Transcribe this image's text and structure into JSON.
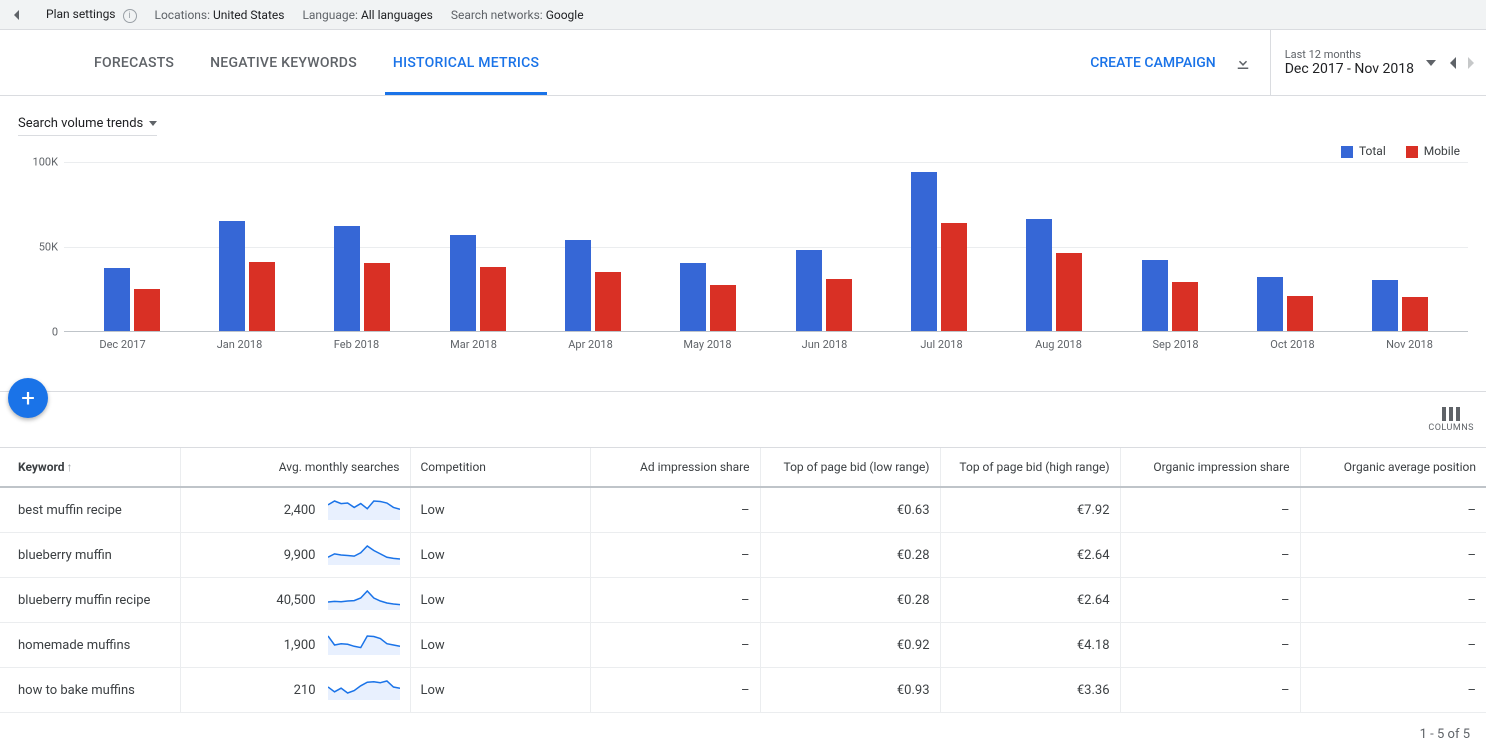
{
  "topbar": {
    "plan_settings": "Plan settings",
    "locations_label": "Locations:",
    "locations_value": "United States",
    "language_label": "Language:",
    "language_value": "All languages",
    "networks_label": "Search networks:",
    "networks_value": "Google"
  },
  "tabs": {
    "forecasts": "FORECASTS",
    "negative": "NEGATIVE KEYWORDS",
    "historical": "HISTORICAL METRICS"
  },
  "actions": {
    "create": "CREATE CAMPAIGN"
  },
  "date_picker": {
    "small": "Last 12 months",
    "range": "Dec 2017 - Nov 2018"
  },
  "chart": {
    "dropdown_label": "Search volume trends",
    "legend_total": "Total",
    "legend_mobile": "Mobile"
  },
  "chart_data": {
    "type": "bar",
    "categories": [
      "Dec 2017",
      "Jan 2018",
      "Feb 2018",
      "Mar 2018",
      "Apr 2018",
      "May 2018",
      "Jun 2018",
      "Jul 2018",
      "Aug 2018",
      "Sep 2018",
      "Oct 2018",
      "Nov 2018"
    ],
    "series": [
      {
        "name": "Total",
        "values": [
          37000,
          65000,
          62000,
          57000,
          54000,
          40000,
          48000,
          94000,
          66000,
          42000,
          32000,
          30000
        ]
      },
      {
        "name": "Mobile",
        "values": [
          25000,
          41000,
          40000,
          38000,
          35000,
          27000,
          31000,
          64000,
          46000,
          29000,
          21000,
          20000
        ]
      }
    ],
    "ylabel": "",
    "xlabel": "",
    "ylim": [
      0,
      100000
    ],
    "yticks": [
      "0",
      "50K",
      "100K"
    ],
    "colors": {
      "Total": "#3667d6",
      "Mobile": "#d93025"
    }
  },
  "columns_btn": "COLUMNS",
  "table": {
    "headers": {
      "keyword": "Keyword",
      "avg": "Avg. monthly searches",
      "competition": "Competition",
      "ad_share": "Ad impression share",
      "bid_low": "Top of page bid (low range)",
      "bid_high": "Top of page bid (high range)",
      "organic_share": "Organic impression share",
      "organic_pos": "Organic average position"
    },
    "rows": [
      {
        "keyword": "best muffin recipe",
        "avg": "2,400",
        "competition": "Low",
        "ad_share": "–",
        "bid_low": "€0.63",
        "bid_high": "€7.92",
        "organic_share": "–",
        "organic_pos": "–",
        "spark": [
          55,
          70,
          60,
          62,
          45,
          60,
          40,
          70,
          68,
          62,
          45,
          38
        ]
      },
      {
        "keyword": "blueberry muffin",
        "avg": "9,900",
        "competition": "Low",
        "ad_share": "–",
        "bid_low": "€0.28",
        "bid_high": "€2.64",
        "organic_share": "–",
        "organic_pos": "–",
        "spark": [
          30,
          45,
          40,
          38,
          35,
          50,
          80,
          60,
          45,
          30,
          25,
          22
        ]
      },
      {
        "keyword": "blueberry muffin recipe",
        "avg": "40,500",
        "competition": "Low",
        "ad_share": "–",
        "bid_low": "€0.28",
        "bid_high": "€2.64",
        "organic_share": "–",
        "organic_pos": "–",
        "spark": [
          35,
          38,
          36,
          40,
          42,
          55,
          90,
          55,
          40,
          30,
          25,
          22
        ]
      },
      {
        "keyword": "homemade muffins",
        "avg": "1,900",
        "competition": "Low",
        "ad_share": "–",
        "bid_low": "€0.92",
        "bid_high": "€4.18",
        "organic_share": "–",
        "organic_pos": "–",
        "spark": [
          70,
          35,
          40,
          38,
          30,
          25,
          70,
          68,
          60,
          40,
          35,
          30
        ]
      },
      {
        "keyword": "how to bake muffins",
        "avg": "210",
        "competition": "Low",
        "ad_share": "–",
        "bid_low": "€0.93",
        "bid_high": "€3.36",
        "organic_share": "–",
        "organic_pos": "–",
        "spark": [
          50,
          30,
          45,
          25,
          35,
          55,
          70,
          72,
          68,
          75,
          50,
          45
        ]
      }
    ]
  },
  "footer": "1 - 5 of 5"
}
